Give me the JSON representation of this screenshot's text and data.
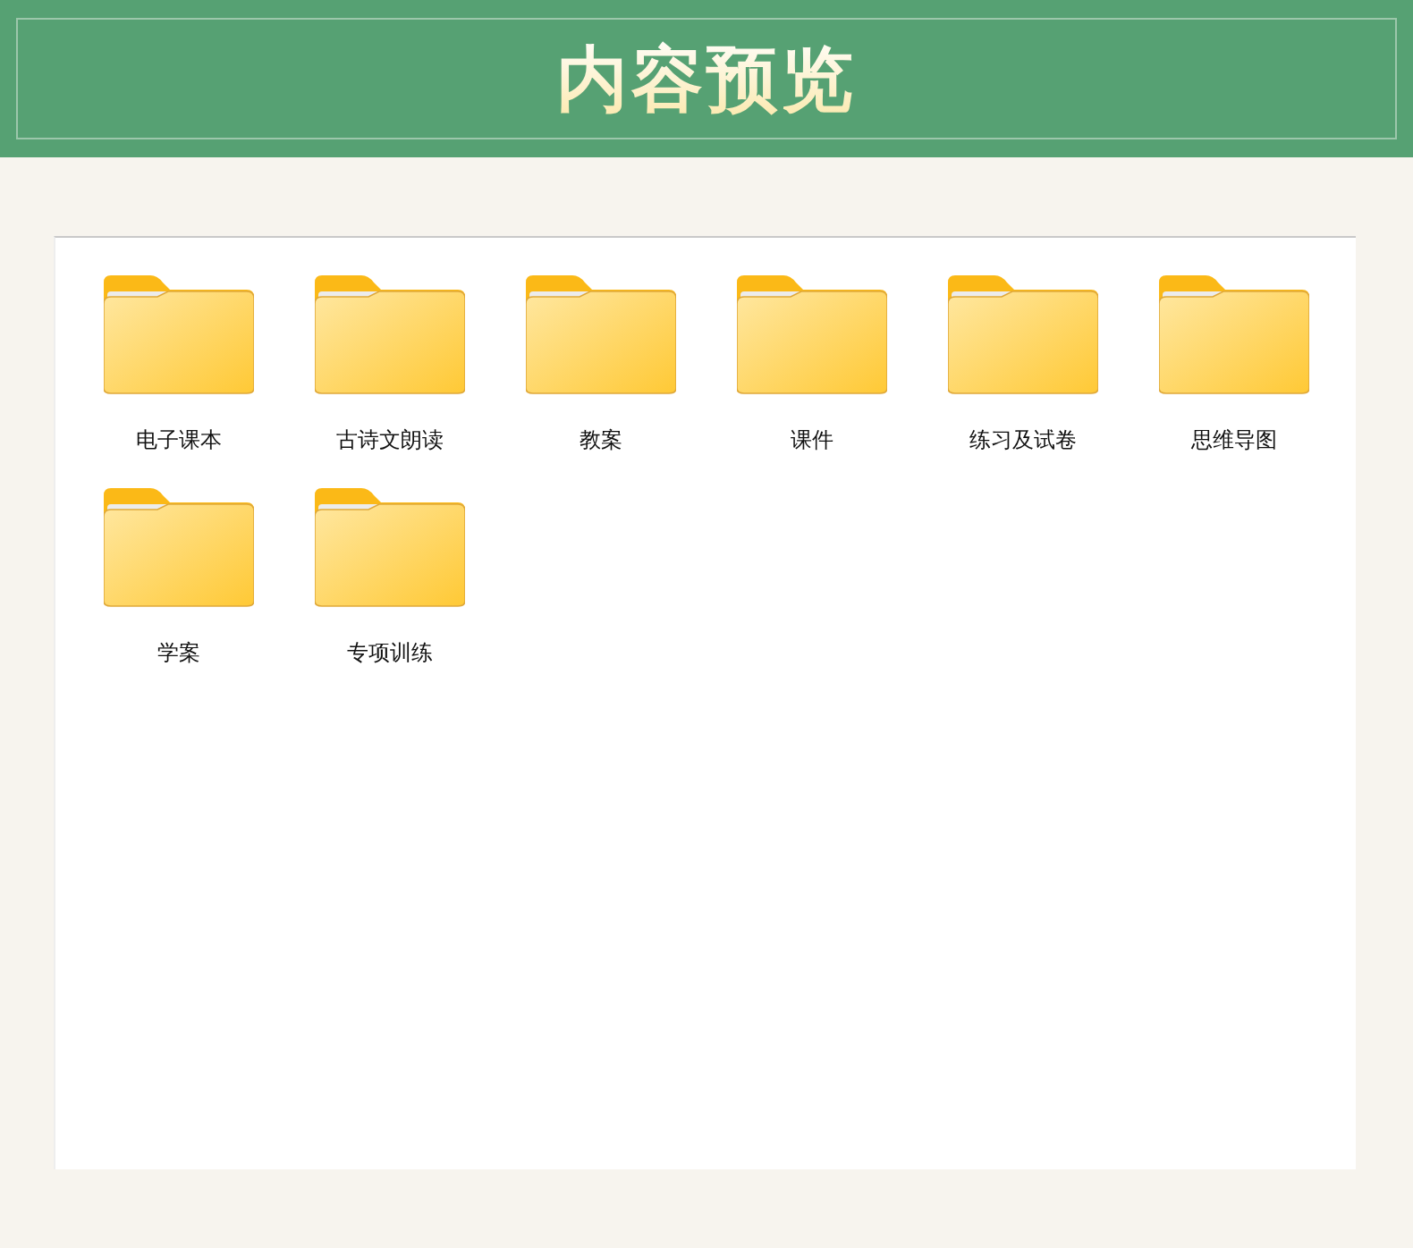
{
  "header": {
    "title": "内容预览"
  },
  "folders": [
    {
      "name": "电子课本"
    },
    {
      "name": "古诗文朗读"
    },
    {
      "name": "教案"
    },
    {
      "name": "课件"
    },
    {
      "name": "练习及试卷"
    },
    {
      "name": "思维导图"
    },
    {
      "name": "学案"
    },
    {
      "name": "专项训练"
    }
  ]
}
